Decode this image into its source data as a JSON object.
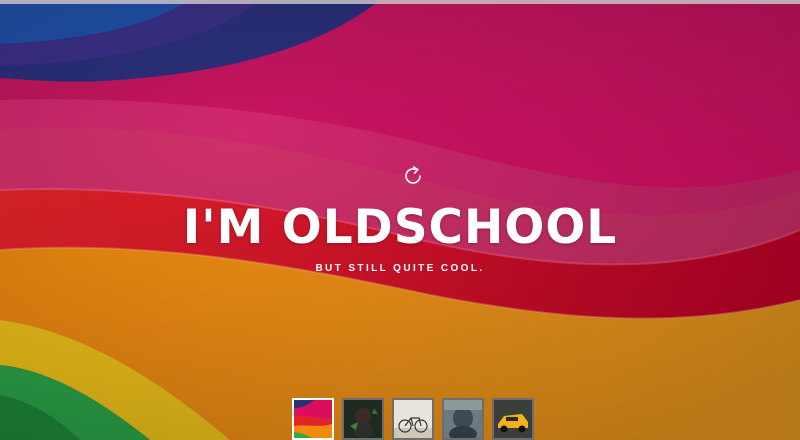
{
  "hero": {
    "title": "I'M OLDSCHOOL",
    "subtitle": "BUT STILL QUITE COOL."
  },
  "controls": {
    "reload_icon": "reload-icon"
  },
  "thumbnails": [
    {
      "name": "rainbow-paper",
      "active": true
    },
    {
      "name": "girl-with-leaves",
      "active": false
    },
    {
      "name": "bicycle",
      "active": false
    },
    {
      "name": "person-hood",
      "active": false
    },
    {
      "name": "yellow-sports-car",
      "active": false
    }
  ],
  "colors": {
    "title": "#ffffff",
    "active_border": "#ffffff",
    "inactive_border": "#6e6e6e"
  }
}
